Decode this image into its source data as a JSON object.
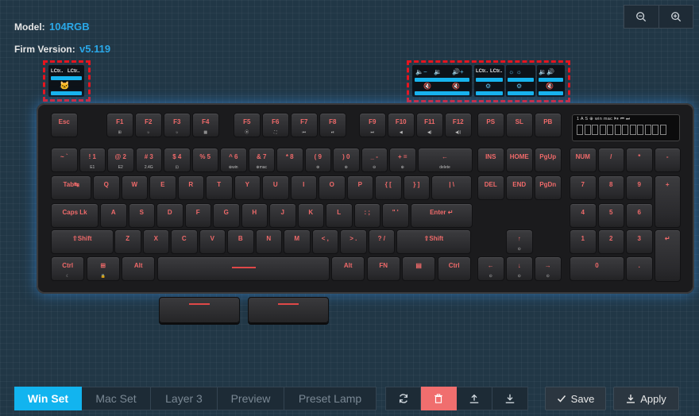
{
  "info": {
    "model_label": "Model:",
    "model_value": "104RGB",
    "firm_label": "Firm Version:",
    "firm_value": "v5.119"
  },
  "zoom": {
    "out_icon": "zoom-out-icon",
    "in_icon": "zoom-in-icon"
  },
  "top_screens": {
    "left_labels": [
      "LCtr..",
      "LCtr.."
    ],
    "right_labels": [
      "LCtr..",
      "LCtr.."
    ]
  },
  "lcd": {
    "status": "1  A  S  ⊕  win  mac         ⏵⏸ ⏮ ⏭"
  },
  "keys": [
    {
      "id": "esc",
      "label": "Esc",
      "sub": ""
    },
    {
      "id": "f1",
      "label": "F1",
      "sub": "⊞"
    },
    {
      "id": "f2",
      "label": "F2",
      "sub": "☼"
    },
    {
      "id": "f3",
      "label": "F3",
      "sub": "☼"
    },
    {
      "id": "f4",
      "label": "F4",
      "sub": "▦"
    },
    {
      "id": "f5",
      "label": "F5",
      "sub": "⦿"
    },
    {
      "id": "f6",
      "label": "F6",
      "sub": "⛶"
    },
    {
      "id": "f7",
      "label": "F7",
      "sub": "⏮"
    },
    {
      "id": "f8",
      "label": "F8",
      "sub": "⏯"
    },
    {
      "id": "f9",
      "label": "F9",
      "sub": "⏭"
    },
    {
      "id": "f10",
      "label": "F10",
      "sub": "◀"
    },
    {
      "id": "f11",
      "label": "F11",
      "sub": "◀)"
    },
    {
      "id": "f12",
      "label": "F12",
      "sub": "◀))"
    },
    {
      "id": "ps",
      "label": "PS",
      "sub": ""
    },
    {
      "id": "sl",
      "label": "SL",
      "sub": ""
    },
    {
      "id": "pb",
      "label": "PB",
      "sub": ""
    },
    {
      "id": "grave",
      "label": "~ `",
      "sub": ""
    },
    {
      "id": "1",
      "label": "! 1",
      "sub": "E1"
    },
    {
      "id": "2",
      "label": "@ 2",
      "sub": "E2"
    },
    {
      "id": "3",
      "label": "# 3",
      "sub": "2.4G"
    },
    {
      "id": "4",
      "label": "$ 4",
      "sub": "⊡"
    },
    {
      "id": "5",
      "label": "% 5",
      "sub": ""
    },
    {
      "id": "6",
      "label": "^ 6",
      "sub": "⊕win"
    },
    {
      "id": "7",
      "label": "& 7",
      "sub": "⊕mac"
    },
    {
      "id": "8",
      "label": "* 8",
      "sub": ""
    },
    {
      "id": "9",
      "label": "( 9",
      "sub": "⊛"
    },
    {
      "id": "0",
      "label": ") 0",
      "sub": "⊛"
    },
    {
      "id": "minus",
      "label": "_ -",
      "sub": "⊖"
    },
    {
      "id": "equal",
      "label": "+ =",
      "sub": "⊕"
    },
    {
      "id": "bksp",
      "label": "←",
      "sub": "delete"
    },
    {
      "id": "ins",
      "label": "INS",
      "sub": ""
    },
    {
      "id": "home",
      "label": "HOME",
      "sub": ""
    },
    {
      "id": "pgup",
      "label": "PgUp",
      "sub": ""
    },
    {
      "id": "num",
      "label": "NUM",
      "sub": ""
    },
    {
      "id": "div",
      "label": "/",
      "sub": ""
    },
    {
      "id": "mul",
      "label": "*",
      "sub": ""
    },
    {
      "id": "sub",
      "label": "-",
      "sub": ""
    },
    {
      "id": "tab",
      "label": "Tab↹",
      "sub": ""
    },
    {
      "id": "q",
      "label": "Q",
      "sub": ""
    },
    {
      "id": "w",
      "label": "W",
      "sub": ""
    },
    {
      "id": "e",
      "label": "E",
      "sub": ""
    },
    {
      "id": "r",
      "label": "R",
      "sub": ""
    },
    {
      "id": "t",
      "label": "T",
      "sub": ""
    },
    {
      "id": "y",
      "label": "Y",
      "sub": ""
    },
    {
      "id": "u",
      "label": "U",
      "sub": ""
    },
    {
      "id": "i",
      "label": "I",
      "sub": ""
    },
    {
      "id": "o",
      "label": "O",
      "sub": ""
    },
    {
      "id": "p",
      "label": "P",
      "sub": ""
    },
    {
      "id": "lbr",
      "label": "{ [",
      "sub": ""
    },
    {
      "id": "rbr",
      "label": "} ]",
      "sub": ""
    },
    {
      "id": "bslash",
      "label": "| \\",
      "sub": ""
    },
    {
      "id": "del",
      "label": "DEL",
      "sub": ""
    },
    {
      "id": "end",
      "label": "END",
      "sub": ""
    },
    {
      "id": "pgdn",
      "label": "PgDn",
      "sub": ""
    },
    {
      "id": "n7",
      "label": "7",
      "sub": ""
    },
    {
      "id": "n8",
      "label": "8",
      "sub": ""
    },
    {
      "id": "n9",
      "label": "9",
      "sub": ""
    },
    {
      "id": "nplus",
      "label": "+",
      "sub": ""
    },
    {
      "id": "caps",
      "label": "Caps Lk",
      "sub": ""
    },
    {
      "id": "a",
      "label": "A",
      "sub": ""
    },
    {
      "id": "s",
      "label": "S",
      "sub": ""
    },
    {
      "id": "d",
      "label": "D",
      "sub": ""
    },
    {
      "id": "f",
      "label": "F",
      "sub": ""
    },
    {
      "id": "g",
      "label": "G",
      "sub": ""
    },
    {
      "id": "h",
      "label": "H",
      "sub": ""
    },
    {
      "id": "j",
      "label": "J",
      "sub": ""
    },
    {
      "id": "k",
      "label": "K",
      "sub": ""
    },
    {
      "id": "l",
      "label": "L",
      "sub": ""
    },
    {
      "id": "semi",
      "label": ": ;",
      "sub": ""
    },
    {
      "id": "quote",
      "label": "\" '",
      "sub": ""
    },
    {
      "id": "enter",
      "label": "Enter ↵",
      "sub": ""
    },
    {
      "id": "n4",
      "label": "4",
      "sub": ""
    },
    {
      "id": "n5",
      "label": "5",
      "sub": ""
    },
    {
      "id": "n6",
      "label": "6",
      "sub": ""
    },
    {
      "id": "lshift",
      "label": "⇧Shift",
      "sub": ""
    },
    {
      "id": "z",
      "label": "Z",
      "sub": ""
    },
    {
      "id": "x",
      "label": "X",
      "sub": ""
    },
    {
      "id": "c",
      "label": "C",
      "sub": ""
    },
    {
      "id": "v",
      "label": "V",
      "sub": ""
    },
    {
      "id": "b",
      "label": "B",
      "sub": ""
    },
    {
      "id": "n",
      "label": "N",
      "sub": ""
    },
    {
      "id": "m",
      "label": "M",
      "sub": ""
    },
    {
      "id": "comma",
      "label": "< ,",
      "sub": ""
    },
    {
      "id": "dot",
      "label": "> .",
      "sub": ""
    },
    {
      "id": "slash",
      "label": "? /",
      "sub": ""
    },
    {
      "id": "rshift",
      "label": "⇧Shift",
      "sub": ""
    },
    {
      "id": "up",
      "label": "↑",
      "sub": "⊙"
    },
    {
      "id": "n1",
      "label": "1",
      "sub": ""
    },
    {
      "id": "n2",
      "label": "2",
      "sub": ""
    },
    {
      "id": "n3",
      "label": "3",
      "sub": ""
    },
    {
      "id": "nenter",
      "label": "↵",
      "sub": ""
    },
    {
      "id": "lctrl",
      "label": "Ctrl",
      "sub": "☾"
    },
    {
      "id": "lwin",
      "label": "⊞",
      "sub": "🔒"
    },
    {
      "id": "lalt",
      "label": "Alt",
      "sub": ""
    },
    {
      "id": "space",
      "label": "",
      "sub": ""
    },
    {
      "id": "ralt",
      "label": "Alt",
      "sub": ""
    },
    {
      "id": "fn",
      "label": "FN",
      "sub": ""
    },
    {
      "id": "menu",
      "label": "▤",
      "sub": ""
    },
    {
      "id": "rctrl",
      "label": "Ctrl",
      "sub": ""
    },
    {
      "id": "left",
      "label": "←",
      "sub": "⊙"
    },
    {
      "id": "down",
      "label": "↓",
      "sub": "⊙"
    },
    {
      "id": "right",
      "label": "→",
      "sub": "⊙"
    },
    {
      "id": "n0",
      "label": "0",
      "sub": ""
    },
    {
      "id": "ndot",
      "label": ".",
      "sub": ""
    }
  ],
  "modes": [
    "Win Set",
    "Mac Set",
    "Layer 3",
    "Preview",
    "Preset Lamp"
  ],
  "active_mode": "Win Set",
  "tools": [
    {
      "name": "refresh",
      "icon": "refresh-icon"
    },
    {
      "name": "delete",
      "icon": "trash-icon"
    },
    {
      "name": "export",
      "icon": "upload-icon"
    },
    {
      "name": "import",
      "icon": "download-icon"
    }
  ],
  "actions": {
    "save_label": "Save",
    "apply_label": "Apply"
  },
  "colors": {
    "accent": "#12b4ef",
    "danger": "#f06e6e",
    "key_legend": "#f06a6a",
    "marker": "#e8141e"
  }
}
